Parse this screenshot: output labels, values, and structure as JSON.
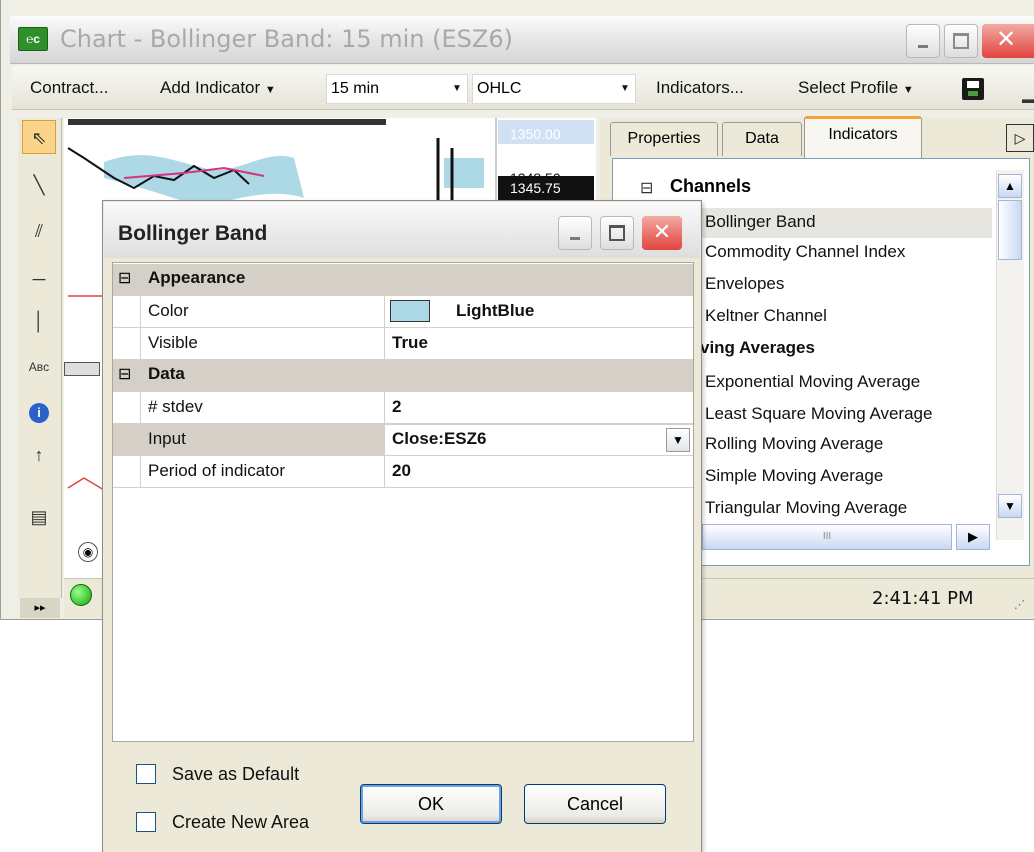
{
  "window": {
    "title": "Chart - Bollinger Band: 15 min (ESZ6)"
  },
  "toolbar": {
    "contract": "Contract...",
    "add_indicator": "Add Indicator",
    "interval": "15 min",
    "chart_type": "OHLC",
    "indicators": "Indicators...",
    "select_profile": "Select Profile"
  },
  "chart": {
    "price_top": "1350.00",
    "price_overlap": "1348.50",
    "price_last": "1345.75"
  },
  "status": {
    "time": "2:41:41 PM"
  },
  "panel": {
    "tabs": [
      "Properties",
      "Data",
      "Indicators"
    ],
    "group_channels": "Channels",
    "channels": [
      "Bollinger Band",
      "Commodity Channel Index",
      "Envelopes",
      "Keltner Channel"
    ],
    "group_ma": "ving Averages",
    "moving_averages": [
      "Exponential Moving Average",
      "Least Square Moving Average",
      "Rolling Moving Average",
      "Simple Moving Average",
      "Triangular Moving Average"
    ],
    "hscroll_grip": "III"
  },
  "dialog": {
    "title": "Bollinger Band",
    "cat_appearance": "Appearance",
    "cat_data": "Data",
    "rows": [
      {
        "label": "Color",
        "value": "LightBlue"
      },
      {
        "label": "Visible",
        "value": "True"
      },
      {
        "label": "# stdev",
        "value": "2"
      },
      {
        "label": "Input",
        "value": "Close:ESZ6"
      },
      {
        "label": "Period of indicator",
        "value": "20"
      }
    ],
    "save_default": "Save as Default",
    "create_area": "Create New Area",
    "ok": "OK",
    "cancel": "Cancel"
  },
  "colors": {
    "band": "#add8e6",
    "accent_close": "#e0443e"
  }
}
